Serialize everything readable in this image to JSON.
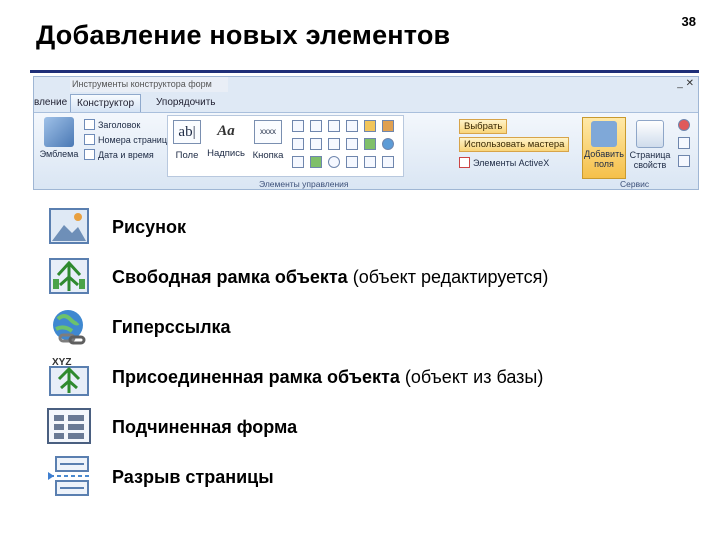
{
  "slide": {
    "number": "38",
    "title": "Добавление новых элементов"
  },
  "ribbon": {
    "context_tab_title": "Инструменты конструктора форм",
    "window_controls": "_ ✕",
    "tabs": [
      {
        "label": "вление"
      },
      {
        "label": "Конструктор"
      },
      {
        "label": "Упорядочить"
      }
    ],
    "left_group": {
      "themes_label": "Эмблема",
      "items": [
        "Заголовок",
        "Номера страниц",
        "Дата и время"
      ]
    },
    "controls": {
      "buttons": [
        "Поле",
        "Надпись",
        "Кнопка"
      ],
      "glyphs": [
        "ab|",
        "Aa",
        "xxxx"
      ],
      "group_label": "Элементы управления"
    },
    "right_group": {
      "select_label": "Выбрать",
      "wizard_label": "Использовать мастера",
      "activex_label": "Элементы ActiveX"
    },
    "service_group": {
      "add_fields_label": "Добавить поля",
      "sheet_label": "Страница свойств",
      "group_label": "Сервис"
    }
  },
  "items": [
    {
      "bold": "Рисунок",
      "note": "",
      "icon": "image-icon"
    },
    {
      "bold": "Свободная рамка объекта",
      "note": " (объект редактируется)",
      "icon": "unbound-object-frame-icon"
    },
    {
      "bold": "Гиперссылка",
      "note": "",
      "icon": "hyperlink-icon"
    },
    {
      "bold": "Присоединенная рамка объекта",
      "note": " (объект из базы)",
      "icon": "bound-object-frame-icon"
    },
    {
      "bold": "Подчиненная форма",
      "note": "",
      "icon": "subform-icon"
    },
    {
      "bold": "Разрыв страницы",
      "note": "",
      "icon": "page-break-icon"
    }
  ],
  "colors": {
    "title_rule": "#1f2f78",
    "ribbon_bg": "#dfe9f5"
  }
}
